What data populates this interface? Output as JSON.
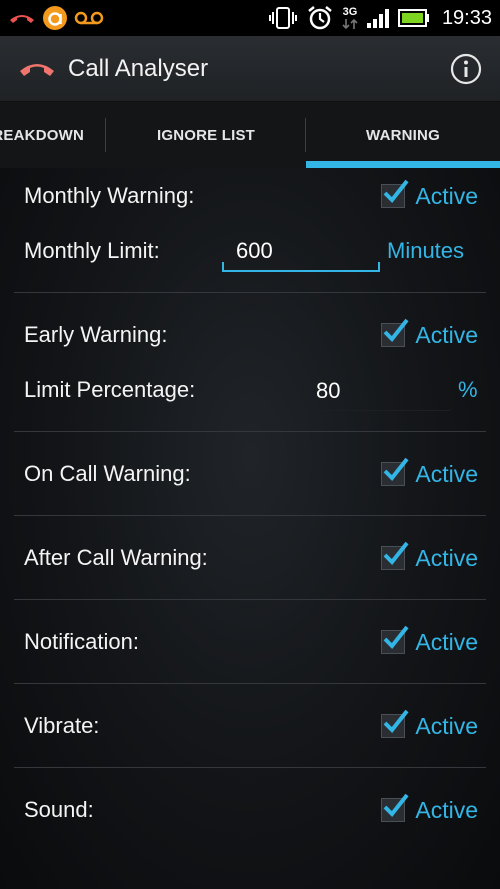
{
  "status_bar": {
    "time": "19:33",
    "network_type": "3G",
    "icons": [
      "missed-call-icon",
      "orange-app-icon",
      "voicemail-icon",
      "vibrate-icon",
      "alarm-icon",
      "network-3g-icon",
      "signal-icon",
      "battery-icon"
    ]
  },
  "action_bar": {
    "title": "Call Analyser",
    "icon": "phone-hangup-icon",
    "info_icon": "info-icon"
  },
  "tabs": [
    {
      "label": "BREAKDOWN",
      "selected": false
    },
    {
      "label": "IGNORE LIST",
      "selected": false
    },
    {
      "label": "WARNING",
      "selected": true
    }
  ],
  "accent_color": "#33b5e5",
  "settings": {
    "monthly_warning": {
      "label": "Monthly Warning:",
      "status": "Active",
      "checked": true
    },
    "monthly_limit": {
      "label": "Monthly Limit:",
      "value": "600",
      "unit": "Minutes"
    },
    "early_warning": {
      "label": "Early Warning:",
      "status": "Active",
      "checked": true
    },
    "limit_percentage": {
      "label": "Limit Percentage:",
      "value": "80",
      "unit": "%"
    },
    "on_call_warning": {
      "label": "On Call Warning:",
      "status": "Active",
      "checked": true
    },
    "after_call_warning": {
      "label": "After Call Warning:",
      "status": "Active",
      "checked": true
    },
    "notification": {
      "label": "Notification:",
      "status": "Active",
      "checked": true
    },
    "vibrate": {
      "label": "Vibrate:",
      "status": "Active",
      "checked": true
    },
    "sound": {
      "label": "Sound:",
      "status": "Active",
      "checked": true
    }
  }
}
